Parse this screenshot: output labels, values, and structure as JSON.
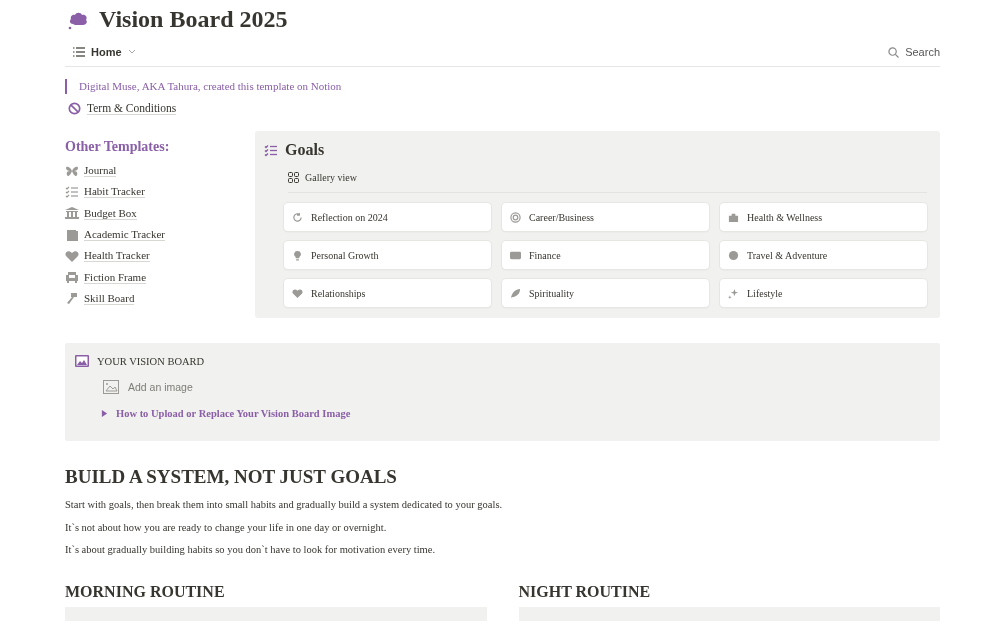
{
  "page": {
    "title": "Vision Board 2025"
  },
  "nav": {
    "view": "Home",
    "search": "Search"
  },
  "quote": "Digital Muse, AKA Tahura, created this template on Notion",
  "terms_link": "Term & Conditions",
  "templates": {
    "heading": "Other Templates:",
    "items": [
      "Journal",
      "Habit Tracker",
      "Budget Box",
      "Academic Tracker",
      "Health Tracker",
      "Fiction Frame",
      "Skill Board"
    ]
  },
  "goals": {
    "title": "Goals",
    "view": "Gallery view",
    "cards": [
      "Reflection on 2024",
      "Career/Business",
      "Health & Wellness",
      "Personal Growth",
      "Finance",
      "Travel & Adventure",
      "Relationships",
      "Spirituality",
      "Lifestyle"
    ]
  },
  "vision_board": {
    "title": "YOUR VISION BOARD",
    "add_image": "Add an image",
    "toggle": {
      "label": "How to Upload or Replace Your Vision Board Image",
      "expanded": false
    }
  },
  "system": {
    "heading": "BUILD A SYSTEM, NOT JUST GOALS",
    "paragraphs": [
      "Start with goals, then break them into small habits and gradually build a system dedicated to your goals.",
      "It`s not about how you are ready to change your life in one day or overnight.",
      "It`s about gradually building habits so you don`t have to look for motivation every time."
    ]
  },
  "routines": [
    {
      "heading": "MORNING ROUTINE"
    },
    {
      "heading": "NIGHT ROUTINE"
    }
  ]
}
